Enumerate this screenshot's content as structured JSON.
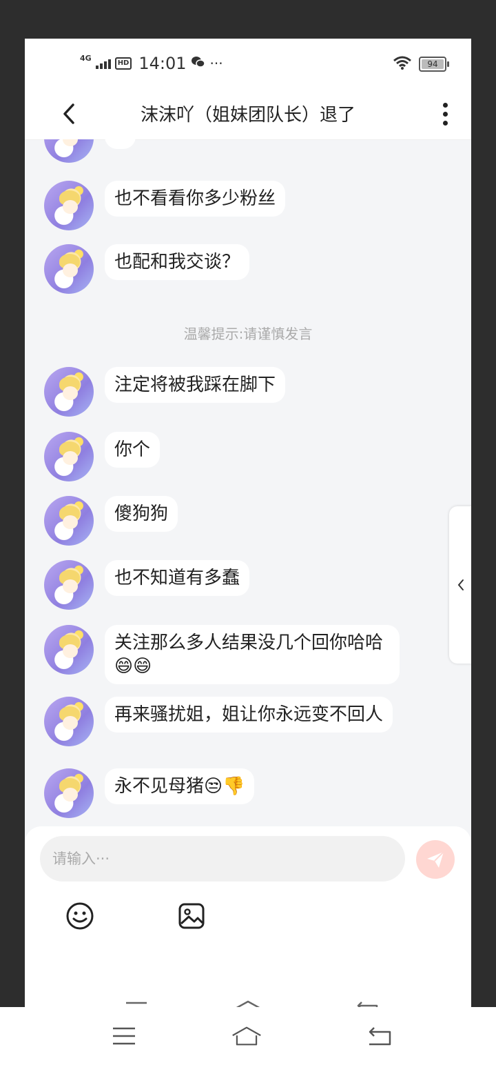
{
  "status_bar": {
    "network": "4G",
    "hd": "HD",
    "time": "14:01",
    "more": "···",
    "battery": "94"
  },
  "header": {
    "title": "沫沫吖（姐妹团队长）退了"
  },
  "messages": [
    {
      "text": "也不看看你多少粉丝"
    },
    {
      "text": "也配和我交谈？"
    },
    {
      "text": "注定将被我踩在脚下"
    },
    {
      "text": "你个"
    },
    {
      "text": "傻狗狗"
    },
    {
      "text": "也不知道有多蠢"
    },
    {
      "text": "关注那么多人结果没几个回你哈哈😄😄"
    },
    {
      "text": "再来骚扰姐，姐让你永远变不回人"
    },
    {
      "text": "永不见母猪😒👎"
    }
  ],
  "notice": "温馨提示:请谨慎发言",
  "input": {
    "placeholder": "请输入···"
  },
  "colors": {
    "send_button": "#ffd7d2",
    "chat_background": "#f4f5f7"
  }
}
